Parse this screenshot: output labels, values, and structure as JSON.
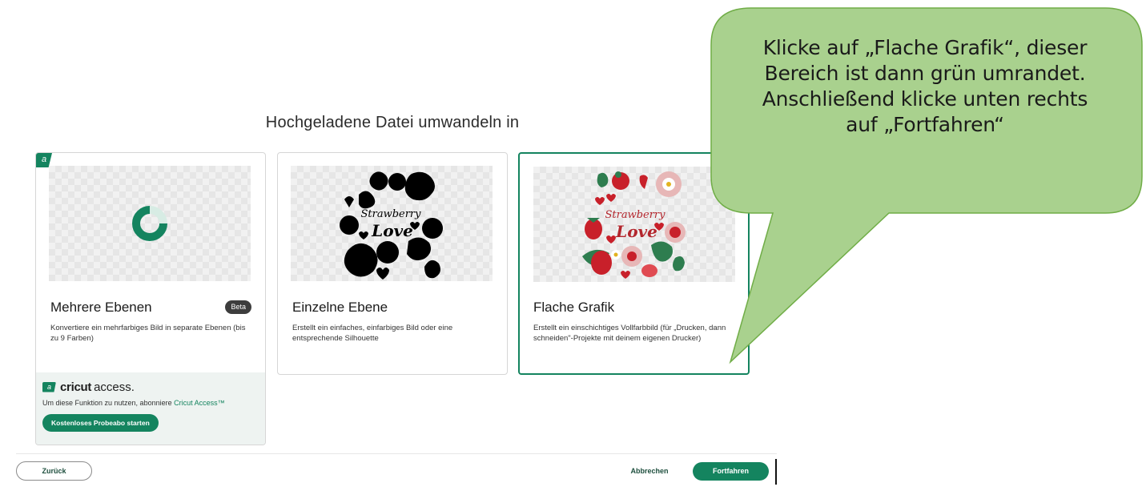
{
  "dialog": {
    "title": "Hochgeladene Datei umwandeln in"
  },
  "cards": [
    {
      "title": "Mehrere Ebenen",
      "badge": "Beta",
      "access_corner": "a",
      "description": "Konvertiere ein mehrfarbiges Bild in separate Ebenen (bis zu 9 Farben)",
      "preview_icon": "loading-ring-icon",
      "selected": false
    },
    {
      "title": "Einzelne Ebene",
      "description": "Erstellt ein einfaches, einfarbiges Bild oder eine entsprechende Silhouette",
      "preview_icon": "silhouette-image",
      "selected": false
    },
    {
      "title": "Flache Grafik",
      "description": "Erstellt ein einschichtiges Vollfarbbild (für „Drucken, dann schneiden\"-Projekte mit deinem eigenen Drucker)",
      "preview_icon": "color-image",
      "selected": true
    }
  ],
  "preview_text": {
    "word1": "Strawberry",
    "word2": "Love"
  },
  "access": {
    "logo_mark": "a",
    "logo_bold": "cricut",
    "logo_light": "access.",
    "text_prefix": "Um diese Funktion zu nutzen, abonniere ",
    "link": "Cricut Access™",
    "button": "Kostenloses Probeabo starten"
  },
  "footer": {
    "back": "Zurück",
    "cancel": "Abbrechen",
    "continue": "Fortfahren"
  },
  "callout": {
    "lines": [
      "Klicke auf „Flache Grafik“, dieser",
      "Bereich ist dann grün umrandet.",
      "Anschließend klicke unten rechts",
      "auf „Fortfahren“"
    ]
  },
  "colors": {
    "accent": "#14845f",
    "callout_fill": "#a9d18e",
    "callout_border": "#70ad47",
    "fruit_red": "#c8202a",
    "leaf_green": "#2e7d4f"
  }
}
